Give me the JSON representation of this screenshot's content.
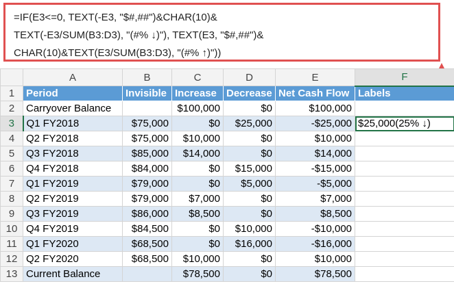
{
  "formula": {
    "lines": [
      "=IF(E3<=0, TEXT(-E3, \"$#,##\")&CHAR(10)&",
      "TEXT(-E3/SUM(B3:D3), \"(#% ↓)\"), TEXT(E3, \"$#,##\")&",
      "CHAR(10)&TEXT(E3/SUM(B3:D3), \"(#% ↑)\"))"
    ]
  },
  "accent_color": "#5b9bd5",
  "selection_color": "#217346",
  "columns": [
    "A",
    "B",
    "C",
    "D",
    "E",
    "F"
  ],
  "row_numbers": [
    "1",
    "2",
    "3",
    "4",
    "5",
    "6",
    "7",
    "8",
    "9",
    "10",
    "11",
    "12",
    "13"
  ],
  "headers": [
    "Period",
    "Invisible",
    "Increase",
    "Decrease",
    "Net Cash Flow",
    "Labels"
  ],
  "rows": [
    [
      "Carryover Balance",
      "",
      "$100,000",
      "$0",
      "$100,000",
      ""
    ],
    [
      "Q1 FY2018",
      "$75,000",
      "$0",
      "$25,000",
      "-$25,000",
      "$25,000(25% ↓)"
    ],
    [
      "Q2 FY2018",
      "$75,000",
      "$10,000",
      "$0",
      "$10,000",
      ""
    ],
    [
      "Q3 FY2018",
      "$85,000",
      "$14,000",
      "$0",
      "$14,000",
      ""
    ],
    [
      "Q4 FY2018",
      "$84,000",
      "$0",
      "$15,000",
      "-$15,000",
      ""
    ],
    [
      "Q1 FY2019",
      "$79,000",
      "$0",
      "$5,000",
      "-$5,000",
      ""
    ],
    [
      "Q2 FY2019",
      "$79,000",
      "$7,000",
      "$0",
      "$7,000",
      ""
    ],
    [
      "Q3 FY2019",
      "$86,000",
      "$8,500",
      "$0",
      "$8,500",
      ""
    ],
    [
      "Q4 FY2019",
      "$84,500",
      "$0",
      "$10,000",
      "-$10,000",
      ""
    ],
    [
      "Q1 FY2020",
      "$68,500",
      "$0",
      "$16,000",
      "-$16,000",
      ""
    ],
    [
      "Q2 FY2020",
      "$68,500",
      "$10,000",
      "$0",
      "$10,000",
      ""
    ],
    [
      "Current Balance",
      "",
      "$78,500",
      "$0",
      "$78,500",
      ""
    ]
  ]
}
